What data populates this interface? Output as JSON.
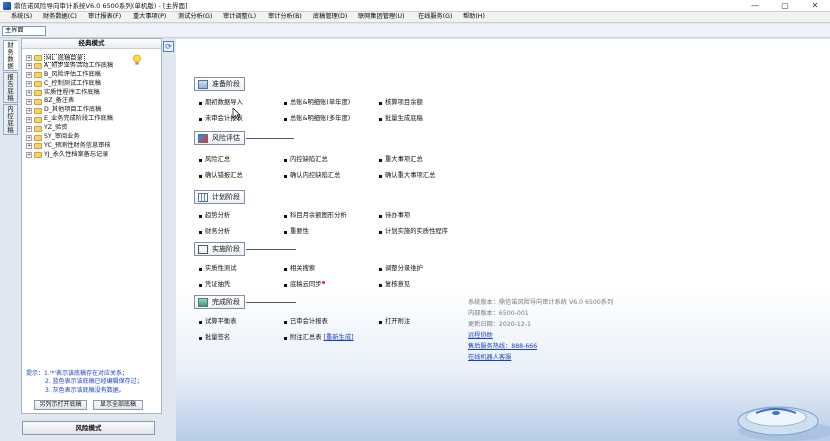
{
  "window": {
    "title": "鼎信诺风险导向审计系统V6.0 6500系列(单机版) - [主界面]",
    "minimize": "—",
    "maximize": "▢",
    "close": "✕"
  },
  "menu": [
    "系统(S)",
    "财务数据(C)",
    "审计报表(F)",
    "重大事项(P)",
    "测试分析(G)",
    "审计调整(L)",
    "审计分析(B)",
    "底稿管理(D)",
    "联网集团管理(U)",
    "在线服务(G)",
    "帮助(H)"
  ],
  "address": {
    "value": "主界面"
  },
  "side_tabs": [
    {
      "label": [
        "财",
        "务",
        "数",
        "据"
      ],
      "active": true
    },
    {
      "label": [
        "报",
        "告",
        "底",
        "稿"
      ],
      "active": false
    },
    {
      "label": [
        "内",
        "控",
        "底",
        "稿"
      ],
      "active": false
    }
  ],
  "tree": {
    "header": "经典模式",
    "items": [
      {
        "code": "ML",
        "label": "底稿目录",
        "selected": true
      },
      {
        "code": "A",
        "label": "初步业务活动工作底稿"
      },
      {
        "code": "B",
        "label": "风险评估工作底稿"
      },
      {
        "code": "C",
        "label": "控制测试工作底稿"
      },
      {
        "code": "",
        "label": "实质性程序工作底稿"
      },
      {
        "code": "BZ",
        "label": "备注表"
      },
      {
        "code": "D",
        "label": "其他项目工作底稿"
      },
      {
        "code": "E",
        "label": "业务完成阶段工作底稿"
      },
      {
        "code": "YZ",
        "label": "验资"
      },
      {
        "code": "SY",
        "label": "审阅业务"
      },
      {
        "code": "YC",
        "label": "预测性财务信息审核"
      },
      {
        "code": "YJ",
        "label": "永久性档案备忘记录"
      }
    ],
    "hints": [
      "提示：1.'*'表示该底稿存在对应关系；",
      "2. 蓝色表示该底稿已经编辑保存过；",
      "3. 灰色表示该底稿没有数据。"
    ],
    "btn_open_list": "另列示打开底稿",
    "btn_show_all": "显示全部底稿",
    "mode_button": "风险模式"
  },
  "main": {
    "refresh_icon": "refresh-icon",
    "stages": [
      {
        "title": "准备阶段",
        "icon": "prepare-icon",
        "items": [
          "期初数据导入",
          "总账&明细账(单年度)",
          "核算项目余额",
          "未审会计报表",
          "总账&明细账(多年度)",
          "批量生成底稿"
        ]
      },
      {
        "title": "风险评估",
        "icon": "risk-icon",
        "items": [
          "风险汇总",
          "内控缺陷汇总",
          "重大事项汇总",
          "确认错报汇总",
          "确认内控缺陷汇总",
          "确认重大事项汇总"
        ]
      },
      {
        "title": "计划阶段",
        "icon": "plan-icon",
        "items": [
          "趋势分析",
          "科目月余额图形分析",
          "待办事项",
          "财务分析",
          "重要性",
          "计划实施的实质性程序"
        ]
      },
      {
        "title": "实施阶段",
        "icon": "execute-icon",
        "items": [
          "实质性测试",
          "相关搜索",
          "调整分录维护",
          "凭证抽凭",
          "底稿云同步",
          "复核意见"
        ]
      },
      {
        "title": "完成阶段",
        "icon": "complete-icon",
        "items": [
          "试算平衡表",
          "已审会计报表",
          "打开附注",
          "批量签名",
          "附注汇总表",
          "[重新生成]"
        ]
      }
    ],
    "version": {
      "version_line": "系统版本：鼎信诺风险导向审计系统 V6.0 6500系列",
      "build_line": "内部版本：6500-001",
      "update_line": "更新日期：2020-12-1",
      "remote_help": "远程协助",
      "hotline": "售后服务热线：888-666",
      "online_bot": "在线机器人客服"
    }
  }
}
